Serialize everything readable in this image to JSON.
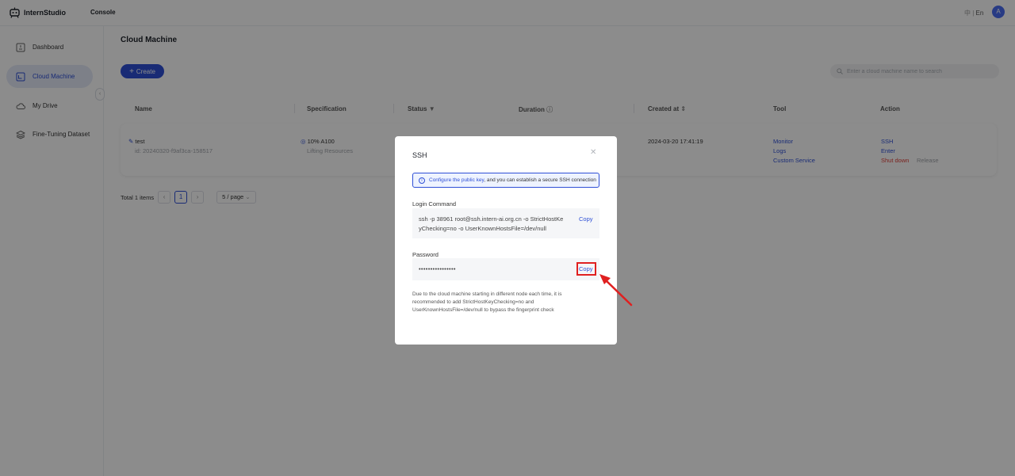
{
  "app": {
    "name": "InternStudio",
    "console": "Console",
    "lang_zh": "中",
    "lang_sep": "|",
    "lang_en": "En",
    "avatar_initial": "A",
    "accent": "#2e4fd6"
  },
  "sidebar": {
    "items": [
      {
        "label": "Dashboard",
        "icon": "dashboard-icon"
      },
      {
        "label": "Cloud Machine",
        "icon": "cloud-machine-icon",
        "active": true
      },
      {
        "label": "My Drive",
        "icon": "cloud-drive-icon"
      },
      {
        "label": "Fine-Tuning Dataset",
        "icon": "dataset-layers-icon"
      }
    ]
  },
  "main": {
    "title": "Cloud Machine",
    "create_label": "Create",
    "search_placeholder": "Enter a cloud machine name to search",
    "columns": [
      "Name",
      "Specification",
      "Status",
      "Duration",
      "Created at",
      "Tool",
      "Action"
    ],
    "row": {
      "name": "test",
      "id": "id: 20240320-f9af3ca-158517",
      "spec": "10% A100",
      "spec_status": "Lifting Resources",
      "created_at": "2024-03-20 17:41:19",
      "tools": [
        "Monitor",
        "Logs",
        "Custom Service"
      ],
      "actions": {
        "ssh": "SSH",
        "enter": "Enter",
        "shutdown": "Shut down",
        "release": "Release"
      }
    },
    "pager": {
      "total": "Total 1 items",
      "current": "1",
      "size": "5 / page"
    }
  },
  "modal": {
    "title": "SSH",
    "info_link": "Configure the public key",
    "info_rest": ", and you can establish a secure SSH connection",
    "login_label": "Login Command",
    "login_command": "ssh -p 38961 root@ssh.intern-ai.org.cn -o StrictHostKeyChecking=no -o UserKnownHostsFile=/dev/null",
    "copy_label": "Copy",
    "password_label": "Password",
    "password_mask": "••••••••••••••••",
    "note": "Due to the cloud machine starting in different node each time, it is recommended to add StrictHostKeyChecking=no and UserKnownHostsFile=/dev/null to bypass the fingerprint check"
  },
  "annotation": {
    "highlight_color": "#e02020"
  }
}
